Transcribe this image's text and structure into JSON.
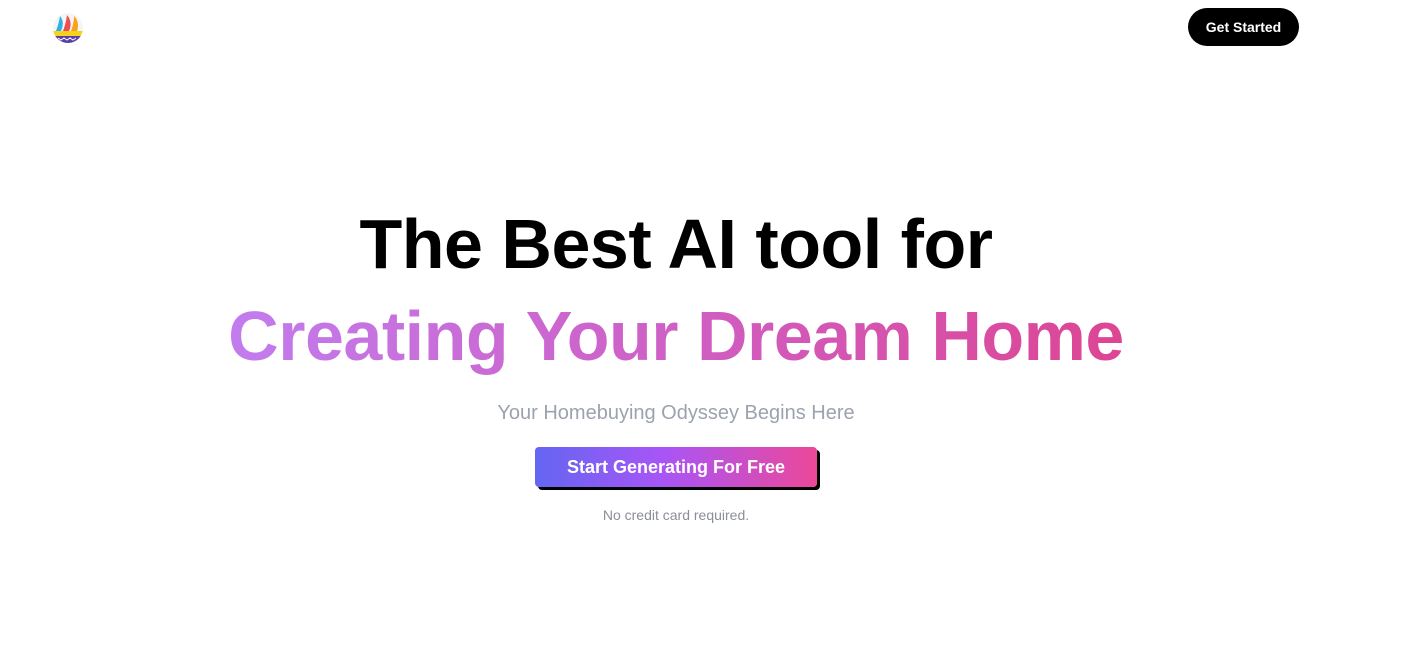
{
  "header": {
    "logo_icon": "sailboat-logo-icon",
    "get_started_label": "Get Started"
  },
  "hero": {
    "headline_line1": "The Best AI tool for",
    "headline_line2": "Creating Your Dream Home",
    "subtitle": "Your Homebuying Odyssey Begins Here",
    "cta_label": "Start Generating For Free",
    "note": "No credit card required."
  },
  "colors": {
    "headline": "#000000",
    "gradient_headline_start": "#c27cee",
    "gradient_headline_end": "#dd4593",
    "cta_gradient_start": "#6366f1",
    "cta_gradient_mid": "#a855f7",
    "cta_gradient_end": "#ec4899",
    "subtitle": "#9ca3af",
    "button_dark": "#000000"
  }
}
